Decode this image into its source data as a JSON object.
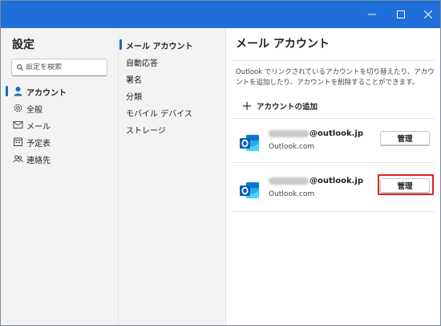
{
  "window": {
    "controls": [
      "minimize",
      "maximize",
      "close"
    ]
  },
  "sidebar": {
    "title": "設定",
    "search_placeholder": "設定を検索",
    "items": [
      {
        "label": "アカウント",
        "icon": "person-icon",
        "active": true
      },
      {
        "label": "全般",
        "icon": "gear-icon",
        "active": false
      },
      {
        "label": "メール",
        "icon": "mail-icon",
        "active": false
      },
      {
        "label": "予定表",
        "icon": "calendar-icon",
        "active": false
      },
      {
        "label": "連絡先",
        "icon": "people-icon",
        "active": false
      }
    ]
  },
  "subnav": {
    "items": [
      {
        "label": "メール アカウント",
        "active": true
      },
      {
        "label": "自動応答",
        "active": false
      },
      {
        "label": "署名",
        "active": false
      },
      {
        "label": "分類",
        "active": false
      },
      {
        "label": "モバイル デバイス",
        "active": false
      },
      {
        "label": "ストレージ",
        "active": false
      }
    ]
  },
  "pane": {
    "title": "メール アカウント",
    "description": "Outlook でリンクされているアカウントを切り替えたり、アカウントを追加したり、アカウントを削除することができます。",
    "add_account_label": "アカウントの追加",
    "accounts": [
      {
        "email_domain": "@outlook.jp",
        "provider": "Outlook.com",
        "manage_label": "管理",
        "highlighted": false
      },
      {
        "email_domain": "@outlook.jp",
        "provider": "Outlook.com",
        "manage_label": "管理",
        "highlighted": true
      }
    ]
  },
  "colors": {
    "titlebar": "#1e6fd9",
    "accent": "#1a67c9",
    "highlight_border": "#e02020",
    "sidebar_bg": "#f3f3f3"
  }
}
